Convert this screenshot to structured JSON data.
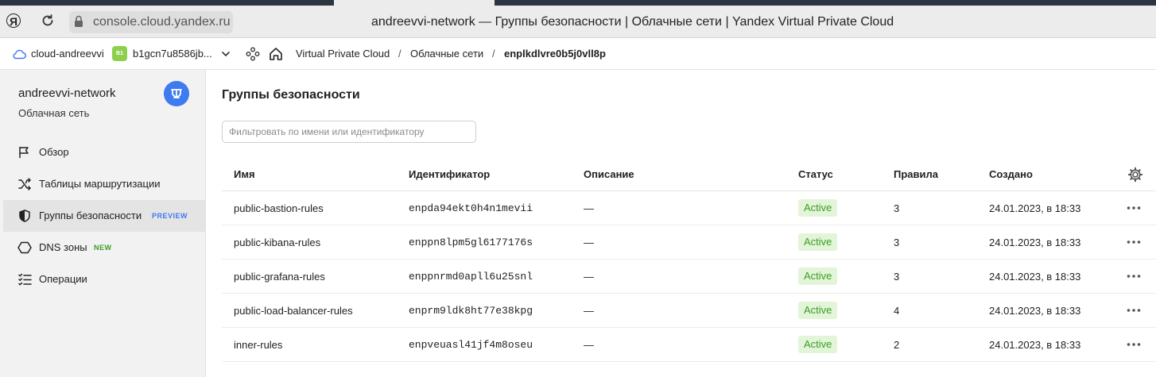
{
  "browser": {
    "url": "console.cloud.yandex.ru",
    "window_title": "andreevvi-network — Группы безопасности | Облачные сети | Yandex Virtual Private Cloud",
    "brand_glyph": "Я"
  },
  "header": {
    "cloud_name": "cloud-andreevvi",
    "folder_badge": "B1",
    "folder_id": "b1gcn7u8586jb...",
    "breadcrumbs": [
      "Virtual Private Cloud",
      "Облачные сети",
      "enplkdlvre0b5j0vll8p"
    ],
    "separator": "/"
  },
  "sidebar": {
    "title": "andreevvi-network",
    "subtitle": "Облачная сеть",
    "items": [
      {
        "label": "Обзор",
        "icon": "flag-icon",
        "tag": ""
      },
      {
        "label": "Таблицы маршрутизации",
        "icon": "shuffle-icon",
        "tag": ""
      },
      {
        "label": "Группы безопасности",
        "icon": "shield-icon",
        "tag": "PREVIEW"
      },
      {
        "label": "DNS зоны",
        "icon": "hexagon-icon",
        "tag": "NEW"
      },
      {
        "label": "Операции",
        "icon": "list-check-icon",
        "tag": ""
      }
    ]
  },
  "main": {
    "title": "Группы безопасности",
    "filter_placeholder": "Фильтровать по имени или идентификатору",
    "columns": [
      "Имя",
      "Идентификатор",
      "Описание",
      "Статус",
      "Правила",
      "Создано"
    ],
    "rows": [
      {
        "name": "public-bastion-rules",
        "id": "enpda94ekt0h4n1mevii",
        "description": "—",
        "status": "Active",
        "rules": "3",
        "created": "24.01.2023, в 18:33"
      },
      {
        "name": "public-kibana-rules",
        "id": "enppn8lpm5gl6177176s",
        "description": "—",
        "status": "Active",
        "rules": "3",
        "created": "24.01.2023, в 18:33"
      },
      {
        "name": "public-grafana-rules",
        "id": "enppnrmd0apll6u25snl",
        "description": "—",
        "status": "Active",
        "rules": "3",
        "created": "24.01.2023, в 18:33"
      },
      {
        "name": "public-load-balancer-rules",
        "id": "enprm9ldk8ht77e38kpg",
        "description": "—",
        "status": "Active",
        "rules": "4",
        "created": "24.01.2023, в 18:33"
      },
      {
        "name": "inner-rules",
        "id": "enpveuasl41jf4m8oseu",
        "description": "—",
        "status": "Active",
        "rules": "2",
        "created": "24.01.2023, в 18:33"
      }
    ]
  },
  "colors": {
    "accent_blue": "#3f7bf0",
    "status_green_bg": "#e3f5d8",
    "status_green_text": "#3a9d23",
    "preview_tag": "#3f7bf0",
    "new_tag": "#3a9d23",
    "folder_badge": "#8ed04e"
  }
}
